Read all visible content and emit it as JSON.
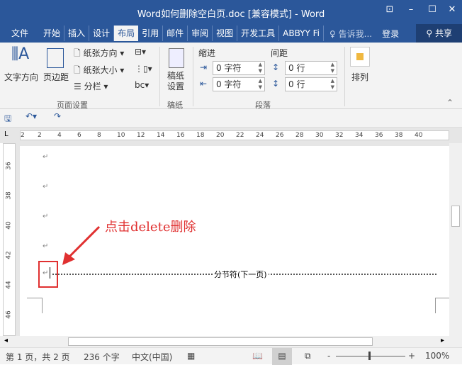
{
  "window": {
    "title": "Word如何删除空白页.doc [兼容模式] - Word",
    "controls": [
      "restore-ribbon",
      "minimize",
      "maximize",
      "close"
    ]
  },
  "tabs": [
    "文件",
    "开始",
    "插入",
    "设计",
    "布局",
    "引用",
    "邮件",
    "审阅",
    "视图",
    "开发工具",
    "ABBYY Fi"
  ],
  "active_tab": "布局",
  "tell_me": "告诉我...",
  "login": "登录",
  "share": "共享",
  "ribbon": {
    "text_direction": "文字方向",
    "margins": "页边距",
    "orientation": "纸张方向",
    "size": "纸张大小",
    "columns": "分栏",
    "page_setup": "页面设置",
    "draft_setup": "稿纸\n设置",
    "draft_line1": "稿纸",
    "draft_line2": "设置",
    "draft_group": "稿纸",
    "indent": "缩进",
    "spacing": "间距",
    "indent_left": "0 字符",
    "indent_right": "0 字符",
    "space_before": "0 行",
    "space_after": "0 行",
    "paragraph": "段落",
    "arrange": "排列"
  },
  "ruler": {
    "h_ticks": [
      "2",
      "2",
      "4",
      "6",
      "8",
      "10",
      "12",
      "14",
      "16",
      "18",
      "20",
      "22",
      "24",
      "26",
      "28",
      "30",
      "32",
      "34",
      "36",
      "38",
      "40"
    ],
    "v_ticks": [
      "36",
      "38",
      "40",
      "42",
      "44",
      "46"
    ]
  },
  "document": {
    "annotation": "点击delete删除",
    "section_break": "分节符(下一页)",
    "accent": "#e03030"
  },
  "status": {
    "page": "第 1 页，共 2 页",
    "words": "236 个字",
    "language": "中文(中国)",
    "zoom": "100%",
    "zoom_level": 100
  }
}
